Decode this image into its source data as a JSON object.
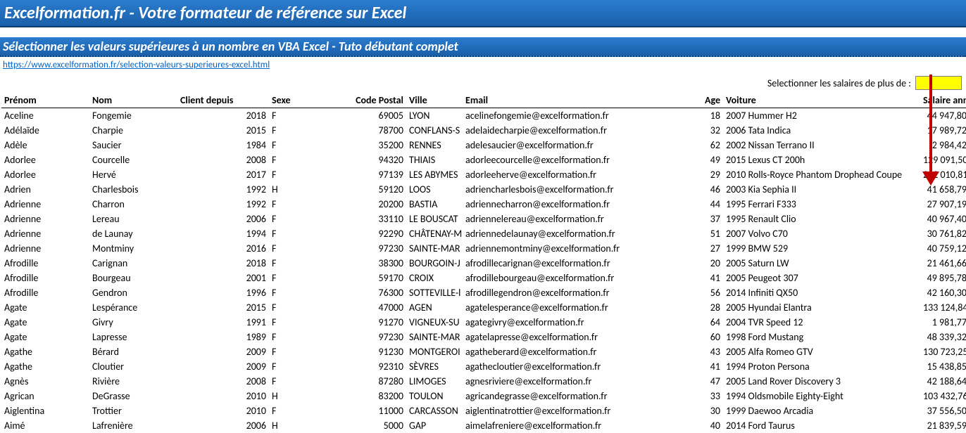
{
  "banner_title": "Excelformation.fr - Votre formateur de référence sur Excel",
  "sub_title": "Sélectionner les valeurs supérieures à un nombre en VBA Excel - Tuto débutant complet",
  "link_text": "https://www.excelformation.fr/selection-valeurs-superieures-excel.html",
  "filter_label": "Selectionner les salaires de plus de :",
  "filter_value": "",
  "headers": {
    "prenom": "Prénom",
    "nom": "Nom",
    "client": "Client depuis",
    "sexe": "Sexe",
    "cp": "Code Postal",
    "ville": "Ville",
    "email": "Email",
    "age": "Age",
    "voiture": "Voiture",
    "salaire": "Salaire annuel"
  },
  "rows": [
    {
      "prenom": "Aceline",
      "nom": "Fongemie",
      "client": "2018",
      "sexe": "F",
      "cp": "69005",
      "ville": "LYON",
      "email": "acelinefongemie@excelformation.fr",
      "age": "18",
      "voiture": "2007 Hummer H2",
      "salaire": "44 947,80"
    },
    {
      "prenom": "Adélaïde",
      "nom": "Charpie",
      "client": "2015",
      "sexe": "F",
      "cp": "78700",
      "ville": "CONFLANS-S",
      "email": "adelaidecharpie@excelformation.fr",
      "age": "32",
      "voiture": "2006 Tata Indica",
      "salaire": "17 989,72"
    },
    {
      "prenom": "Adèle",
      "nom": "Saucier",
      "client": "1984",
      "sexe": "F",
      "cp": "35200",
      "ville": "RENNES",
      "email": "adelesaucier@excelformation.fr",
      "age": "62",
      "voiture": "2002 Nissan Terrano II",
      "salaire": "2 984,42"
    },
    {
      "prenom": "Adorlee",
      "nom": "Courcelle",
      "client": "2008",
      "sexe": "F",
      "cp": "94320",
      "ville": "THIAIS",
      "email": "adorleecourcelle@excelformation.fr",
      "age": "49",
      "voiture": "2015 Lexus CT 200h",
      "salaire": "129 091,50"
    },
    {
      "prenom": "Adorlee",
      "nom": "Hervé",
      "client": "2017",
      "sexe": "F",
      "cp": "97139",
      "ville": "LES ABYMES",
      "email": "adorleeherve@excelformation.fr",
      "age": "29",
      "voiture": "2010 Rolls-Royce Phantom Drophead Coupe",
      "salaire": "232 010,81"
    },
    {
      "prenom": "Adrien",
      "nom": "Charlesbois",
      "client": "1992",
      "sexe": "H",
      "cp": "59120",
      "ville": "LOOS",
      "email": "adriencharlesbois@excelformation.fr",
      "age": "46",
      "voiture": "2003 Kia Sephia II",
      "salaire": "41 658,79"
    },
    {
      "prenom": "Adrienne",
      "nom": "Charron",
      "client": "1992",
      "sexe": "F",
      "cp": "20200",
      "ville": "BASTIA",
      "email": "adriennecharron@excelformation.fr",
      "age": "44",
      "voiture": "1995 Ferrari F333",
      "salaire": "27 907,19"
    },
    {
      "prenom": "Adrienne",
      "nom": "Lereau",
      "client": "2006",
      "sexe": "F",
      "cp": "33110",
      "ville": "LE BOUSCAT",
      "email": "adriennelereau@excelformation.fr",
      "age": "37",
      "voiture": "1995 Renault Clio",
      "salaire": "40 967,40"
    },
    {
      "prenom": "Adrienne",
      "nom": "de Launay",
      "client": "1994",
      "sexe": "F",
      "cp": "92290",
      "ville": "CHÂTENAY-M",
      "email": "adriennedelaunay@excelformation.fr",
      "age": "51",
      "voiture": "2007 Volvo C70",
      "salaire": "30 761,82"
    },
    {
      "prenom": "Adrienne",
      "nom": "Montminy",
      "client": "2016",
      "sexe": "F",
      "cp": "97230",
      "ville": "SAINTE-MAR",
      "email": "adriennemontminy@excelformation.fr",
      "age": "27",
      "voiture": "1999 BMW 529",
      "salaire": "40 759,12"
    },
    {
      "prenom": "Afrodille",
      "nom": "Carignan",
      "client": "2018",
      "sexe": "F",
      "cp": "38300",
      "ville": "BOURGOIN-J",
      "email": "afrodillecarignan@excelformation.fr",
      "age": "20",
      "voiture": "2005 Saturn LW",
      "salaire": "21 461,66"
    },
    {
      "prenom": "Afrodille",
      "nom": "Bourgeau",
      "client": "2001",
      "sexe": "F",
      "cp": "59170",
      "ville": "CROIX",
      "email": "afrodillebourgeau@excelformation.fr",
      "age": "41",
      "voiture": "2005 Peugeot 307",
      "salaire": "49 895,78"
    },
    {
      "prenom": "Afrodille",
      "nom": "Gendron",
      "client": "1996",
      "sexe": "F",
      "cp": "76300",
      "ville": "SOTTEVILLE-l",
      "email": "afrodillegendron@excelformation.fr",
      "age": "56",
      "voiture": "2014 Infiniti QX50",
      "salaire": "42 160,30"
    },
    {
      "prenom": "Agate",
      "nom": "Lespérance",
      "client": "2015",
      "sexe": "F",
      "cp": "47000",
      "ville": "AGEN",
      "email": "agatelesperance@excelformation.fr",
      "age": "28",
      "voiture": "2005 Hyundai Elantra",
      "salaire": "133 124,84"
    },
    {
      "prenom": "Agate",
      "nom": "Givry",
      "client": "1991",
      "sexe": "F",
      "cp": "91270",
      "ville": "VIGNEUX-SU",
      "email": "agategivry@excelformation.fr",
      "age": "64",
      "voiture": "2004 TVR Speed 12",
      "salaire": "1 981,77"
    },
    {
      "prenom": "Agate",
      "nom": "Lapresse",
      "client": "1989",
      "sexe": "F",
      "cp": "97230",
      "ville": "SAINTE-MAR",
      "email": "agatelapresse@excelformation.fr",
      "age": "60",
      "voiture": "1998 Ford Mustang",
      "salaire": "48 339,32"
    },
    {
      "prenom": "Agathe",
      "nom": "Bérard",
      "client": "2009",
      "sexe": "F",
      "cp": "91230",
      "ville": "MONTGEROI",
      "email": "agatheberard@excelformation.fr",
      "age": "43",
      "voiture": "2005 Alfa Romeo GTV",
      "salaire": "130 723,25"
    },
    {
      "prenom": "Agathe",
      "nom": "Cloutier",
      "client": "2009",
      "sexe": "F",
      "cp": "92310",
      "ville": "SÈVRES",
      "email": "agathecloutier@excelformation.fr",
      "age": "41",
      "voiture": "1994 Proton Persona",
      "salaire": "15 438,85"
    },
    {
      "prenom": "Agnès",
      "nom": "Rivière",
      "client": "2008",
      "sexe": "F",
      "cp": "87280",
      "ville": "LIMOGES",
      "email": "agnesriviere@excelformation.fr",
      "age": "47",
      "voiture": "2005 Land Rover Discovery 3",
      "salaire": "42 188,64"
    },
    {
      "prenom": "Agrican",
      "nom": "DeGrasse",
      "client": "2010",
      "sexe": "H",
      "cp": "83200",
      "ville": "TOULON",
      "email": "agricandegrasse@excelformation.fr",
      "age": "33",
      "voiture": "1994 Oldsmobile Eighty-Eight",
      "salaire": "103 432,76"
    },
    {
      "prenom": "Aiglentina",
      "nom": "Trottier",
      "client": "2010",
      "sexe": "F",
      "cp": "11000",
      "ville": "CARCASSON",
      "email": "aiglentinatrottier@excelformation.fr",
      "age": "30",
      "voiture": "1999 Daewoo Arcadia",
      "salaire": "37 556,50"
    },
    {
      "prenom": "Aimé",
      "nom": "Lafrenière",
      "client": "2006",
      "sexe": "H",
      "cp": "5000",
      "ville": "GAP",
      "email": "aimelafreniere@excelformation.fr",
      "age": "40",
      "voiture": "2014 Ford Taurus",
      "salaire": "21 839,59"
    }
  ]
}
